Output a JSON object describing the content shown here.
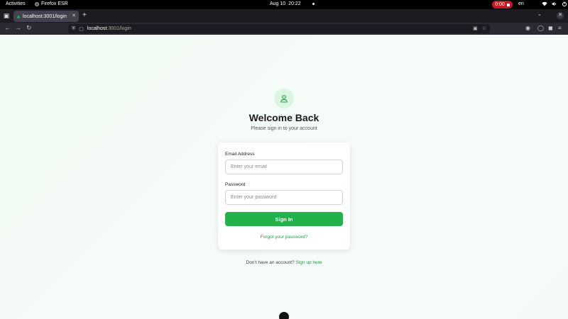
{
  "system_bar": {
    "activities": "Activities",
    "app_name": "Firefox ESR",
    "date": "Aug 10",
    "time": "20:22",
    "recording_time": "0:00",
    "language": "en",
    "record_color": "#c01c28"
  },
  "browser": {
    "tab_title": "localhost:3001/login",
    "url_host": "localhost",
    "url_path": ":3001/login"
  },
  "page": {
    "title": "Welcome Back",
    "subtitle": "Please sign in to your account",
    "icon": "user-icon",
    "form": {
      "email_label": "Email Address",
      "email_placeholder": "Enter your email",
      "password_label": "Password",
      "password_placeholder": "Enter your password",
      "submit_label": "Sign In",
      "forgot_link": "Forgot your password?"
    },
    "signup_prompt": "Don't have an account?",
    "signup_link": "Sign up here",
    "accent_color": "#22b24c"
  }
}
